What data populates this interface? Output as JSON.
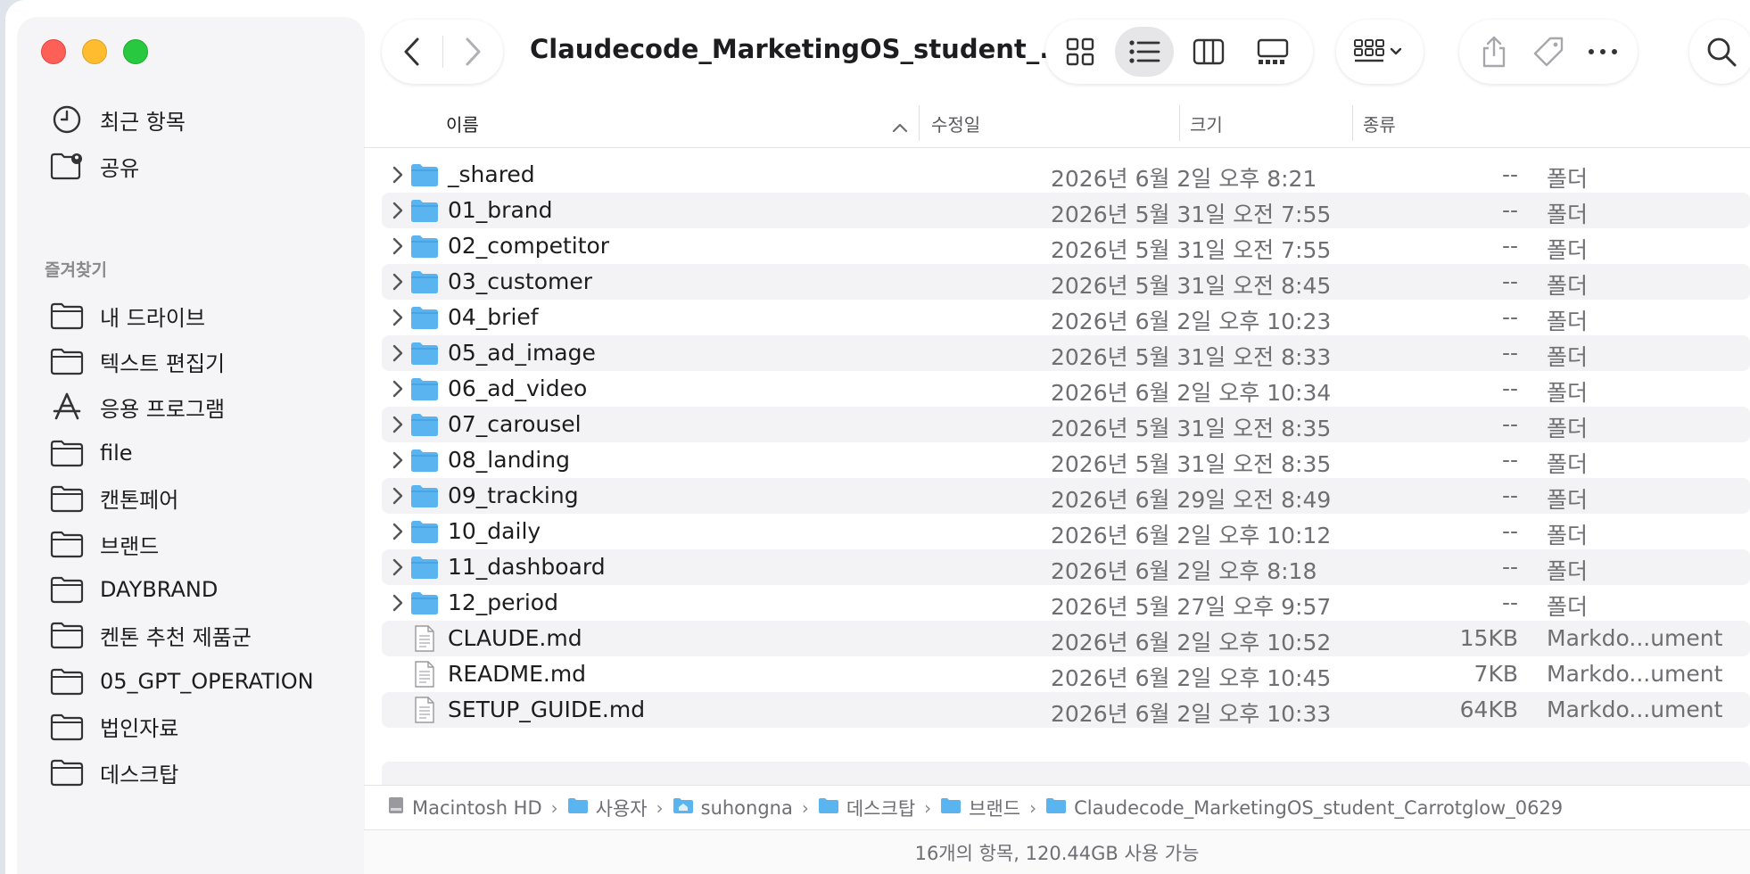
{
  "window": {
    "title": "Claudecode_MarketingOS_student_..."
  },
  "sidebar": {
    "top_items": [
      {
        "label": "최근 항목",
        "icon": "clock-icon"
      },
      {
        "label": "공유",
        "icon": "shared-folder-icon"
      }
    ],
    "favorites_heading": "즐겨찾기",
    "favorites": [
      {
        "label": "내 드라이브",
        "icon": "folder-icon"
      },
      {
        "label": "텍스트 편집기",
        "icon": "folder-icon"
      },
      {
        "label": "응용 프로그램",
        "icon": "applications-icon"
      },
      {
        "label": "file",
        "icon": "folder-icon"
      },
      {
        "label": "캔톤페어",
        "icon": "folder-icon"
      },
      {
        "label": "브랜드",
        "icon": "folder-icon"
      },
      {
        "label": "DAYBRAND",
        "icon": "folder-icon"
      },
      {
        "label": "켄톤 추천 제품군",
        "icon": "folder-icon"
      },
      {
        "label": "05_GPT_OPERATION",
        "icon": "folder-icon"
      },
      {
        "label": "법인자료",
        "icon": "folder-icon"
      },
      {
        "label": "데스크탑",
        "icon": "folder-icon"
      }
    ]
  },
  "toolbar": {
    "back_icon": "chevron-left-icon",
    "forward_icon": "chevron-right-icon",
    "views": [
      "icon-view-icon",
      "list-view-icon",
      "column-view-icon",
      "gallery-view-icon"
    ],
    "active_view": "list-view-icon",
    "group_icon": "group-by-icon",
    "actions": [
      "share-icon",
      "tag-icon",
      "more-icon"
    ],
    "search_icon": "search-icon"
  },
  "columns": {
    "name": "이름",
    "modified": "수정일",
    "size": "크기",
    "kind": "종류"
  },
  "rows": [
    {
      "name": "_shared",
      "date": "2026년 6월 2일 오후 8:21",
      "size": "--",
      "kind": "폴더",
      "type": "folder"
    },
    {
      "name": "01_brand",
      "date": "2026년 5월 31일 오전 7:55",
      "size": "--",
      "kind": "폴더",
      "type": "folder"
    },
    {
      "name": "02_competitor",
      "date": "2026년 5월 31일 오전 7:55",
      "size": "--",
      "kind": "폴더",
      "type": "folder"
    },
    {
      "name": "03_customer",
      "date": "2026년 5월 31일 오전 8:45",
      "size": "--",
      "kind": "폴더",
      "type": "folder"
    },
    {
      "name": "04_brief",
      "date": "2026년 6월 2일 오후 10:23",
      "size": "--",
      "kind": "폴더",
      "type": "folder"
    },
    {
      "name": "05_ad_image",
      "date": "2026년 5월 31일 오전 8:33",
      "size": "--",
      "kind": "폴더",
      "type": "folder"
    },
    {
      "name": "06_ad_video",
      "date": "2026년 6월 2일 오후 10:34",
      "size": "--",
      "kind": "폴더",
      "type": "folder"
    },
    {
      "name": "07_carousel",
      "date": "2026년 5월 31일 오전 8:35",
      "size": "--",
      "kind": "폴더",
      "type": "folder"
    },
    {
      "name": "08_landing",
      "date": "2026년 5월 31일 오전 8:35",
      "size": "--",
      "kind": "폴더",
      "type": "folder"
    },
    {
      "name": "09_tracking",
      "date": "2026년 6월 29일 오전 8:49",
      "size": "--",
      "kind": "폴더",
      "type": "folder"
    },
    {
      "name": "10_daily",
      "date": "2026년 6월 2일 오후 10:12",
      "size": "--",
      "kind": "폴더",
      "type": "folder"
    },
    {
      "name": "11_dashboard",
      "date": "2026년 6월 2일 오후 8:18",
      "size": "--",
      "kind": "폴더",
      "type": "folder"
    },
    {
      "name": "12_period",
      "date": "2026년 5월 27일 오후 9:57",
      "size": "--",
      "kind": "폴더",
      "type": "folder"
    },
    {
      "name": "CLAUDE.md",
      "date": "2026년 6월 2일 오후 10:52",
      "size": "15KB",
      "kind": "Markdo...ument",
      "type": "file"
    },
    {
      "name": "README.md",
      "date": "2026년 6월 2일 오후 10:45",
      "size": "7KB",
      "kind": "Markdo...ument",
      "type": "file"
    },
    {
      "name": "SETUP_GUIDE.md",
      "date": "2026년 6월 2일 오후 10:33",
      "size": "64KB",
      "kind": "Markdo...ument",
      "type": "file"
    }
  ],
  "pathbar": [
    {
      "label": "Macintosh HD",
      "icon": "disk-icon"
    },
    {
      "label": "사용자",
      "icon": "folder-icon"
    },
    {
      "label": "suhongna",
      "icon": "home-icon"
    },
    {
      "label": "데스크탑",
      "icon": "folder-icon"
    },
    {
      "label": "브랜드",
      "icon": "folder-icon"
    },
    {
      "label": "Claudecode_MarketingOS_student_Carrotglow_0629",
      "icon": "folder-icon"
    }
  ],
  "status": "16개의 항목, 120.44GB 사용 가능",
  "colors": {
    "folder": "#5ab4f0",
    "close": "#fe5f57",
    "minimize": "#febc2e",
    "zoom": "#28c840"
  }
}
